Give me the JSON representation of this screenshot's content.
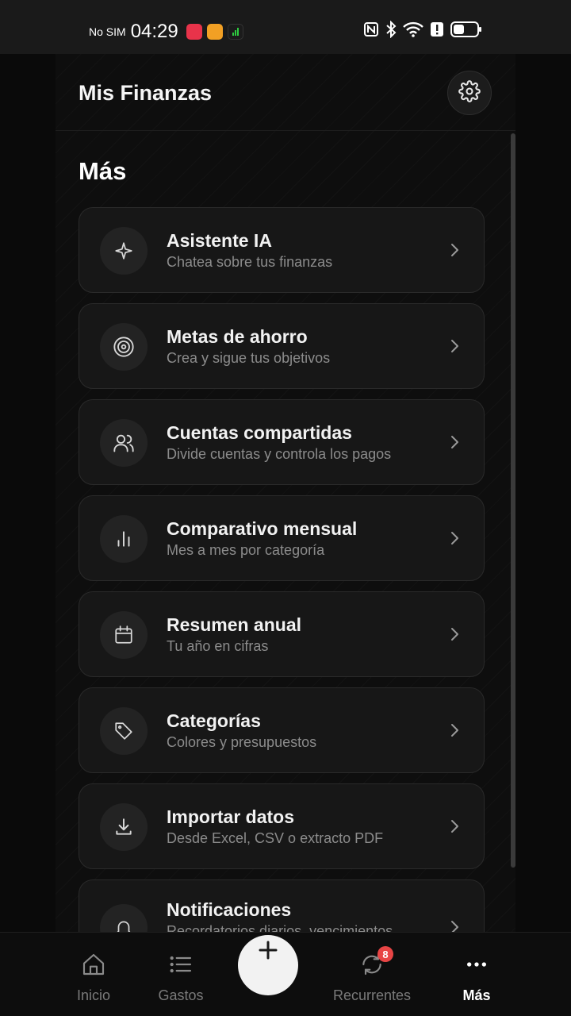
{
  "status_bar": {
    "carrier": "No SIM",
    "time": "04:29",
    "icons": [
      "app-red-icon",
      "app-orange-icon",
      "signal-app-icon",
      "nfc-icon",
      "bluetooth-icon",
      "wifi-icon",
      "alert-icon",
      "battery-icon"
    ]
  },
  "header": {
    "title": "Mis Finanzas",
    "settings_icon": "gear-icon"
  },
  "page": {
    "title": "Más"
  },
  "menu": [
    {
      "icon": "sparkle-icon",
      "title": "Asistente IA",
      "subtitle": "Chatea sobre tus finanzas"
    },
    {
      "icon": "target-icon",
      "title": "Metas de ahorro",
      "subtitle": "Crea y sigue tus objetivos"
    },
    {
      "icon": "users-icon",
      "title": "Cuentas compartidas",
      "subtitle": "Divide cuentas y controla los pagos"
    },
    {
      "icon": "bar-chart-icon",
      "title": "Comparativo mensual",
      "subtitle": "Mes a mes por categoría"
    },
    {
      "icon": "calendar-icon",
      "title": "Resumen anual",
      "subtitle": "Tu año en cifras"
    },
    {
      "icon": "tag-icon",
      "title": "Categorías",
      "subtitle": "Colores y presupuestos"
    },
    {
      "icon": "download-icon",
      "title": "Importar datos",
      "subtitle": "Desde Excel, CSV o extracto PDF"
    },
    {
      "icon": "bell-icon",
      "title": "Notificaciones",
      "subtitle": "Recordatorios diarios, vencimientos"
    }
  ],
  "bottom_nav": {
    "items": [
      {
        "icon": "home-icon",
        "label": "Inicio"
      },
      {
        "icon": "list-icon",
        "label": "Gastos"
      },
      {
        "icon": "plus-icon",
        "label": ""
      },
      {
        "icon": "refresh-icon",
        "label": "Recurrentes",
        "badge": "8"
      },
      {
        "icon": "more-icon",
        "label": "Más",
        "active": true
      }
    ]
  }
}
